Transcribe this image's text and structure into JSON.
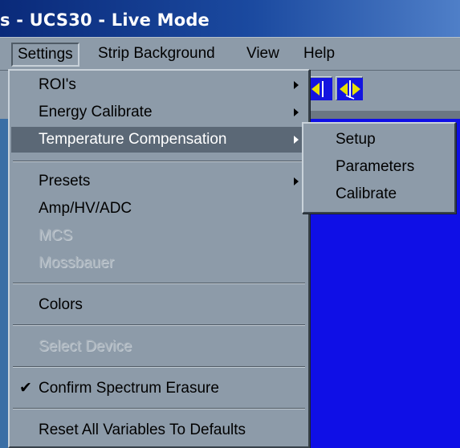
{
  "window": {
    "title": "s - UCS30 - Live Mode"
  },
  "menubar": {
    "items": [
      {
        "label": "Settings",
        "active": true
      },
      {
        "label": "Strip Background"
      },
      {
        "label": "View"
      },
      {
        "label": "Help"
      }
    ]
  },
  "toolbar": {
    "icons": [
      "marker-left-icon",
      "marker-split-icon"
    ]
  },
  "settings_menu": {
    "items": [
      {
        "label": "ROI's",
        "submenu": true
      },
      {
        "label": "Energy Calibrate",
        "submenu": true
      },
      {
        "label": "Temperature Compensation",
        "submenu": true,
        "highlighted": true
      },
      {
        "label": "Presets",
        "submenu": true
      },
      {
        "label": "Amp/HV/ADC"
      },
      {
        "label": "MCS",
        "disabled": true
      },
      {
        "label": "Mossbauer",
        "disabled": true
      },
      {
        "label": "Colors"
      },
      {
        "label": "Select Device",
        "disabled": true
      },
      {
        "label": "Confirm Spectrum Erasure",
        "checked": true
      },
      {
        "label": "Reset All Variables To Defaults"
      }
    ]
  },
  "temperature_submenu": {
    "items": [
      {
        "label": "Setup"
      },
      {
        "label": "Parameters"
      },
      {
        "label": "Calibrate"
      }
    ]
  },
  "colors": {
    "menu_bg": "#8d9ba9",
    "highlight": "#5b6876",
    "workspace": "#0f0fe6",
    "title_gradient_start": "#0a2a7a"
  }
}
